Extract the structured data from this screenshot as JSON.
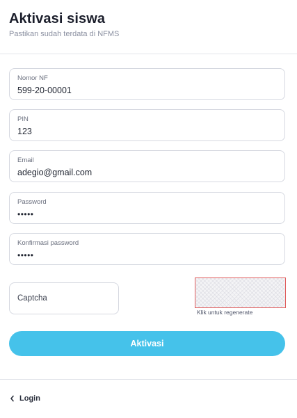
{
  "header": {
    "title": "Aktivasi siswa",
    "subtitle": "Pastikan sudah terdata di NFMS"
  },
  "form": {
    "fields": [
      {
        "label": "Nomor NF",
        "value": "599-20-00001"
      },
      {
        "label": "PIN",
        "value": "123"
      },
      {
        "label": "Email",
        "value": "adegio@gmail.com"
      },
      {
        "label": "Password",
        "value": "•••••"
      },
      {
        "label": "Konfirmasi password",
        "value": "•••••"
      }
    ],
    "captcha": {
      "placeholder": "Captcha",
      "hint": "Klik untuk regenerate"
    },
    "submit_label": "Aktivasi"
  },
  "footer": {
    "login_label": "Login",
    "login_icon": "chevron-left-icon"
  },
  "colors": {
    "accent": "#45c2ea",
    "captcha_border": "#e05a5a"
  }
}
